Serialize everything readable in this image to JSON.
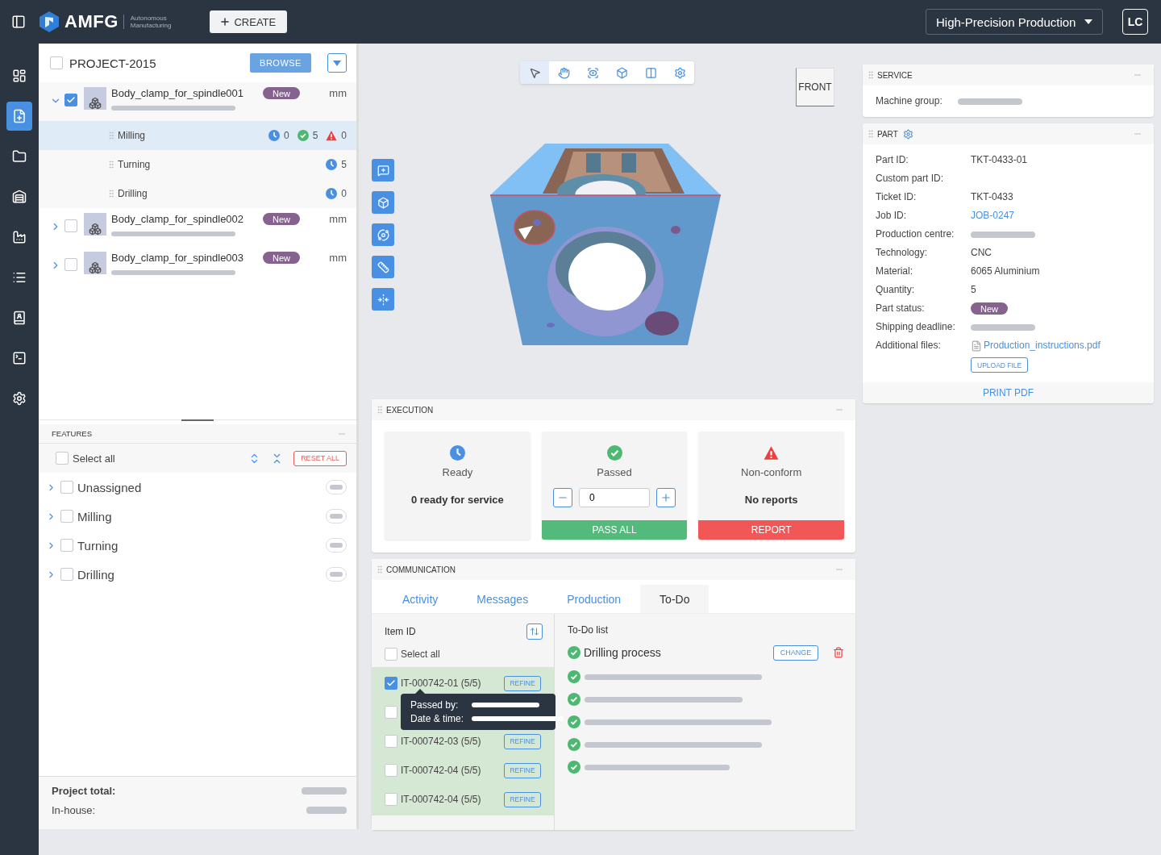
{
  "top_bar": {
    "brand": "AMFG",
    "tagline": [
      "Autonomous",
      "Manufacturing"
    ],
    "create_button": "CREATE",
    "workspace": "High-Precision Production",
    "avatar": "LC"
  },
  "sidebar": {
    "items": [
      {
        "kind": "dashboard",
        "selected": false
      },
      {
        "kind": "new-file",
        "selected": true
      },
      {
        "kind": "folder",
        "selected": false
      },
      {
        "kind": "building",
        "selected": false
      },
      {
        "kind": "factory",
        "selected": false
      },
      {
        "kind": "list",
        "selected": false
      },
      {
        "kind": "contacts",
        "selected": false
      },
      {
        "kind": "terminal",
        "selected": false
      },
      {
        "kind": "settings",
        "selected": false
      }
    ]
  },
  "project": {
    "title": "PROJECT-2015",
    "checked": false,
    "browse_button": "BROWSE",
    "parts": [
      {
        "name": "Body_clamp_for_spindle001",
        "status": "New",
        "unit": "mm",
        "checked": true,
        "expanded": true,
        "operations": [
          {
            "name": "Milling",
            "selected": true,
            "counts": [
              {
                "kind": "ready",
                "value": "0"
              },
              {
                "kind": "passed",
                "value": "5"
              },
              {
                "kind": "nonconform",
                "value": "0"
              }
            ]
          },
          {
            "name": "Turning",
            "selected": false,
            "counts": [
              {
                "kind": "ready",
                "value": "5"
              }
            ]
          },
          {
            "name": "Drilling",
            "selected": false,
            "counts": [
              {
                "kind": "ready",
                "value": "0"
              }
            ]
          }
        ]
      },
      {
        "name": "Body_clamp_for_spindle002",
        "status": "New",
        "unit": "mm",
        "checked": false,
        "expanded": false
      },
      {
        "name": "Body_clamp_for_spindle003",
        "status": "New",
        "unit": "mm",
        "checked": false,
        "expanded": false
      }
    ]
  },
  "features": {
    "title": "FEATURES",
    "select_all": {
      "label": "Select all",
      "checked": false
    },
    "reset_button": "RESET ALL",
    "groups": [
      {
        "name": "Unassigned",
        "checked": false,
        "expanded": false
      },
      {
        "name": "Milling",
        "checked": false,
        "expanded": false
      },
      {
        "name": "Turning",
        "checked": false,
        "expanded": false
      },
      {
        "name": "Drilling",
        "checked": false,
        "expanded": false
      }
    ]
  },
  "totals": [
    {
      "label": "Project total:",
      "bold": true
    },
    {
      "label": "In-house:",
      "bold": false
    }
  ],
  "viewer": {
    "tools": [
      {
        "kind": "select",
        "selected": true
      },
      {
        "kind": "pan",
        "selected": false
      },
      {
        "kind": "focus",
        "selected": false
      },
      {
        "kind": "view",
        "selected": false
      },
      {
        "kind": "section",
        "selected": false
      },
      {
        "kind": "settings",
        "selected": false
      }
    ],
    "view_cube": "FRONT"
  },
  "execution": {
    "title": "EXECUTION",
    "cards": [
      {
        "kind": "ready",
        "title": "Ready",
        "summary": "0 ready for service"
      },
      {
        "kind": "passed",
        "title": "Passed",
        "value": "0",
        "button": "PASS ALL"
      },
      {
        "kind": "nonconform",
        "title": "Non-conform",
        "summary": "No reports",
        "button": "REPORT"
      }
    ]
  },
  "communication": {
    "title": "COMMUNICATION",
    "tabs": [
      {
        "label": "Activity",
        "selected": false
      },
      {
        "label": "Messages",
        "selected": false
      },
      {
        "label": "Production",
        "selected": false
      },
      {
        "label": "To-Do",
        "selected": true
      }
    ],
    "items_header": "Item ID",
    "select_all": {
      "label": "Select all",
      "checked": false
    },
    "items": [
      {
        "id": "IT-000742-01 (5/5)",
        "checked": true,
        "button": "REFINE"
      },
      {
        "checked": false
      },
      {
        "id": "IT-000742-03 (5/5)",
        "checked": false,
        "button": "REFINE"
      },
      {
        "id": "IT-000742-04 (5/5)",
        "checked": false,
        "button": "REFINE"
      },
      {
        "id": "IT-000742-04 (5/5)",
        "checked": false,
        "button": "REFINE"
      }
    ],
    "tooltip": {
      "lines": [
        "Passed by:",
        "Date & time:"
      ]
    },
    "todo": {
      "title": "To-Do list",
      "task": "Drilling process",
      "task_done": true,
      "change_button": "CHANGE",
      "steps": [
        {
          "done": true
        },
        {
          "done": true
        },
        {
          "done": true
        },
        {
          "done": true
        },
        {
          "done": true
        }
      ]
    }
  },
  "service": {
    "title": "SERVICE",
    "rows": [
      {
        "label": "Machine group:",
        "kind": "blurred"
      }
    ]
  },
  "part": {
    "title": "PART",
    "rows": [
      {
        "label": "Part ID:",
        "kind": "text",
        "value": "TKT-0433-01"
      },
      {
        "label": "Custom part ID:",
        "kind": "empty"
      },
      {
        "label": "Ticket ID:",
        "kind": "text",
        "value": "TKT-0433"
      },
      {
        "label": "Job ID:",
        "kind": "link",
        "value": "JOB-0247"
      },
      {
        "label": "Production centre:",
        "kind": "blurred"
      },
      {
        "label": "Technology:",
        "kind": "text",
        "value": "CNC"
      },
      {
        "label": "Material:",
        "kind": "text",
        "value": "6065 Aluminium"
      },
      {
        "label": "Quantity:",
        "kind": "text",
        "value": "5"
      },
      {
        "label": "Part status:",
        "kind": "badge",
        "value": "New"
      },
      {
        "label": "Shipping deadline:",
        "kind": "blurred"
      },
      {
        "label": "Additional files:",
        "kind": "file",
        "value": "Production_instructions.pdf",
        "button": "UPLOAD FILE"
      }
    ],
    "print_button": "PRINT PDF"
  }
}
